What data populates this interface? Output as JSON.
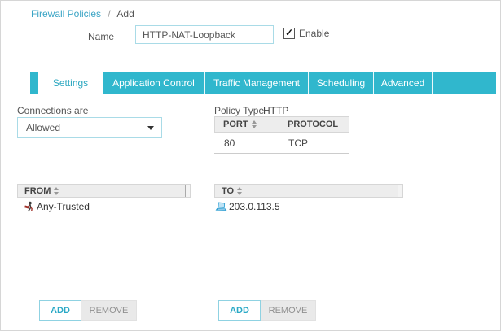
{
  "colors": {
    "accent_teal": "#30b7cd",
    "link_teal": "#3aa4c5",
    "header_gray": "#ededed",
    "host_icon_blue": "#2e9fd3",
    "alias_icon_dark": "#3d3d3d",
    "alias_icon_red": "#a03028"
  },
  "breadcrumb": {
    "link": "Firewall Policies",
    "separator": "/",
    "current": "Add"
  },
  "name_field": {
    "label": "Name",
    "value": "HTTP-NAT-Loopback"
  },
  "enable": {
    "label": "Enable",
    "checked": true
  },
  "tabs": [
    {
      "label": "Settings",
      "active": true
    },
    {
      "label": "Application Control",
      "active": false
    },
    {
      "label": "Traffic Management",
      "active": false
    },
    {
      "label": "Scheduling",
      "active": false
    },
    {
      "label": "Advanced",
      "active": false
    }
  ],
  "connections": {
    "label": "Connections are",
    "selected": "Allowed"
  },
  "policy_type": {
    "label": "Policy Type",
    "value": "HTTP",
    "columns": [
      "PORT",
      "PROTOCOL"
    ],
    "rows": [
      [
        "80",
        "TCP"
      ]
    ]
  },
  "from_panel": {
    "header": "FROM",
    "items": [
      {
        "icon": "alias-icon",
        "label": "Any-Trusted"
      }
    ],
    "add_label": "ADD",
    "remove_label": "REMOVE"
  },
  "to_panel": {
    "header": "TO",
    "items": [
      {
        "icon": "host-icon",
        "label": "203.0.113.5"
      }
    ],
    "add_label": "ADD",
    "remove_label": "REMOVE"
  }
}
